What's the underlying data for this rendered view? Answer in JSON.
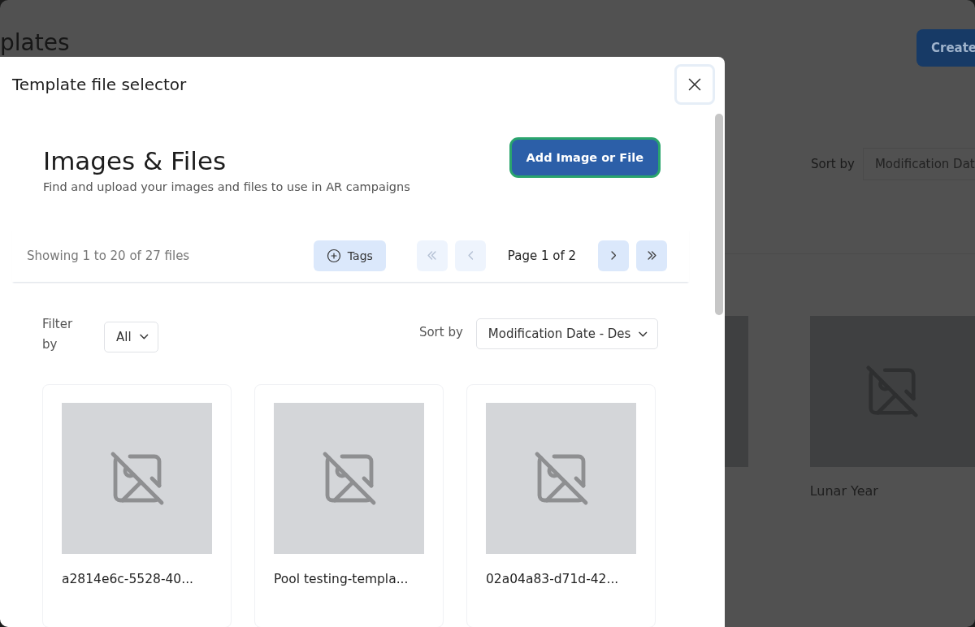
{
  "background_page": {
    "title": "plates",
    "create_button": "Create",
    "sort_label": "Sort by",
    "sort_value": "Modification Dat",
    "cards": [
      {
        "kind": "partial"
      },
      {
        "name": "Lunar Year",
        "kind": "full"
      }
    ]
  },
  "dialog": {
    "title": "Template file selector",
    "heading": "Images & Files",
    "subtitle": "Find and upload your images and files to use in AR campaigns",
    "add_button": "Add Image or File",
    "summary": "Showing 1 to 20 of 27 files",
    "tags_button": "Tags",
    "pagination": [
      {
        "kind": "first",
        "disabled": true
      },
      {
        "kind": "prev",
        "disabled": true
      },
      {
        "kind": "label",
        "text": "Page 1 of 2"
      },
      {
        "kind": "next",
        "disabled": false
      },
      {
        "kind": "last",
        "disabled": false
      }
    ],
    "filter": {
      "label": "Filter by",
      "value": "All"
    },
    "sort": {
      "label": "Sort by",
      "value": "Modification Date - Des"
    },
    "files": [
      {
        "name": "a2814e6c-5528-40..."
      },
      {
        "name": "Pool testing-templa..."
      },
      {
        "name": "02a04a83-d71d-42..."
      }
    ]
  }
}
